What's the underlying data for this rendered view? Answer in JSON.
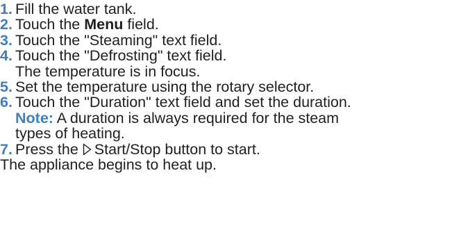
{
  "steps": [
    {
      "number": "1.",
      "text": "Fill the water tank."
    },
    {
      "number": "2.",
      "text_before": "Touch the ",
      "bold": "Menu",
      "text_after": " field."
    },
    {
      "number": "3.",
      "text": "Touch the \"Steaming\" text field."
    },
    {
      "number": "4.",
      "text": "Touch the \"Defrosting\" text field.",
      "subtext": "The temperature is in focus."
    },
    {
      "number": "5.",
      "text": "Set the temperature using the rotary selector."
    },
    {
      "number": "6.",
      "text": "Touch the \"Duration\" text field and set the duration.",
      "note": {
        "label": "Note:",
        "line1": " A duration is always required for the steam",
        "line2": "types of heating."
      }
    },
    {
      "number": "7.",
      "text_before": "Press the ",
      "icon": "start-stop-icon",
      "text_after": "Start/Stop button to start."
    }
  ],
  "result": "The appliance begins to heat up.",
  "colors": {
    "accent": "#3d7fbf",
    "text": "#1f1f1f"
  }
}
